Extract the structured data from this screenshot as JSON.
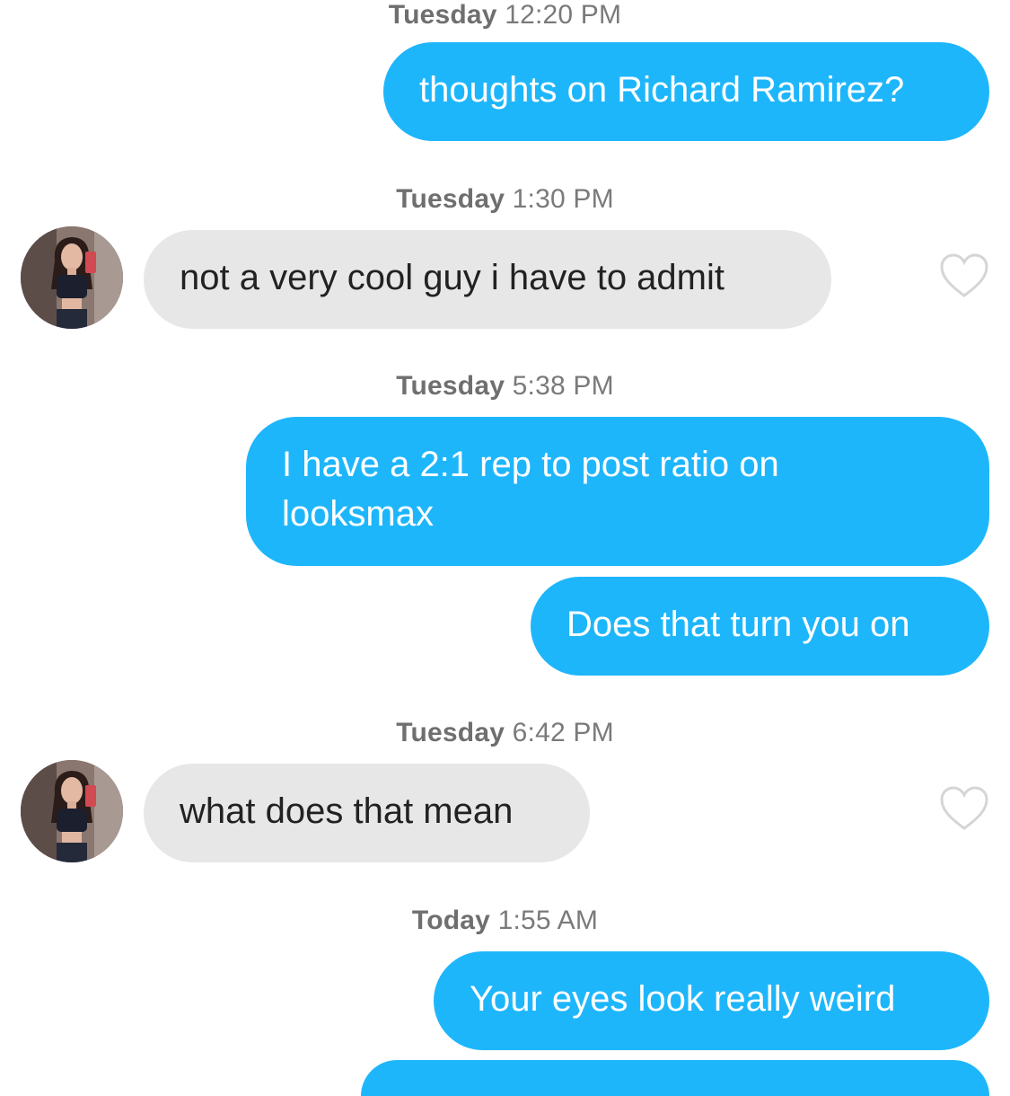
{
  "colors": {
    "outgoing_bubble": "#1eb6fb",
    "incoming_bubble": "#e7e7e7",
    "timestamp_text": "#7a7a7a"
  },
  "messages": [
    {
      "day": "Tuesday",
      "time": "12:20 PM",
      "direction": "outgoing",
      "text": "thoughts on Richard Ramirez?"
    },
    {
      "day": "Tuesday",
      "time": "1:30 PM",
      "direction": "incoming",
      "text": "not a very cool guy i have to admit",
      "icons": [
        "avatar",
        "heart-icon"
      ]
    },
    {
      "day": "Tuesday",
      "time": "5:38 PM",
      "direction": "outgoing",
      "lines": [
        "I have a 2:1 rep to post ratio on",
        "looksmax"
      ]
    },
    {
      "direction": "outgoing",
      "text": "Does that turn you on"
    },
    {
      "day": "Tuesday",
      "time": "6:42 PM",
      "direction": "incoming",
      "text": "what does that mean",
      "icons": [
        "avatar",
        "heart-icon"
      ]
    },
    {
      "day": "Today",
      "time": "1:55 AM",
      "direction": "outgoing",
      "text": "Your eyes look really weird"
    }
  ]
}
